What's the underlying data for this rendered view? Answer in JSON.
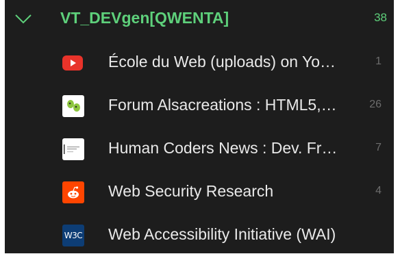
{
  "group": {
    "title": "VT_DEVgen[QWENTA]",
    "count": "38",
    "expand_icon": "chevron-down-icon"
  },
  "feeds": [
    {
      "label": "École du Web (uploads) on Yo…",
      "count": "1",
      "icon": "youtube-icon"
    },
    {
      "label": "Forum Alsacreations : HTML5,…",
      "count": "26",
      "icon": "alsacreations-icon"
    },
    {
      "label": "Human Coders News : Dev. Fr…",
      "count": "7",
      "icon": "human-coders-icon"
    },
    {
      "label": "Web Security Research",
      "count": "4",
      "icon": "reddit-icon"
    },
    {
      "label": "Web Accessibility Initiative (WAI)",
      "count": "",
      "icon": "w3c-icon"
    }
  ],
  "icon_text": {
    "w3c": "W3C"
  },
  "colors": {
    "background": "#1d1d1d",
    "group_accent": "#5ed07b",
    "feed_text": "#e9e9e9",
    "count_text": "#6d6d6d",
    "youtube": "#e8332a",
    "reddit": "#ff4500",
    "w3c": "#0d3d75"
  }
}
